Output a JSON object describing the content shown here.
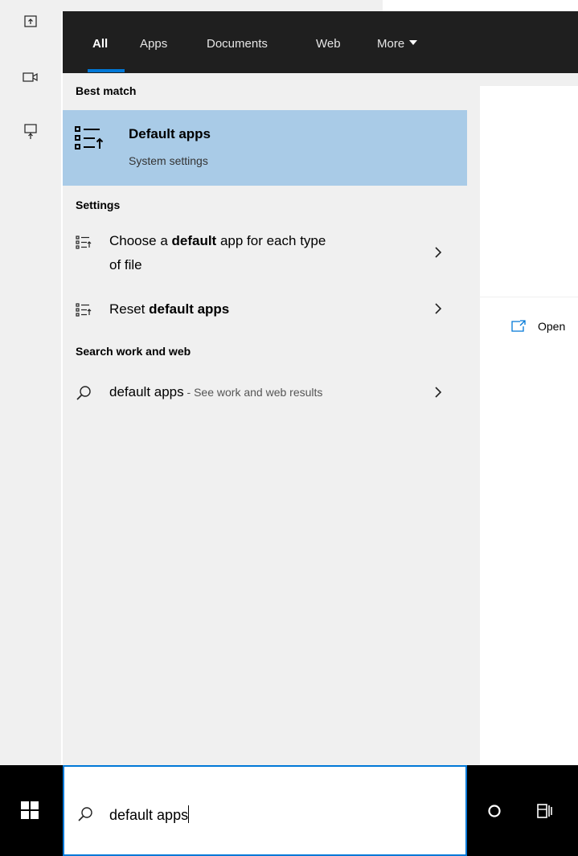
{
  "tabs": {
    "all": "All",
    "apps": "Apps",
    "documents": "Documents",
    "web": "Web",
    "more": "More"
  },
  "sections": {
    "best_match": "Best match",
    "settings": "Settings",
    "search_web": "Search work and web"
  },
  "best_match": {
    "title": "Default apps",
    "subtitle": "System settings",
    "icon": "default-apps-icon"
  },
  "settings_results": [
    {
      "prefix": "Choose a ",
      "bold": "default",
      "suffix_line1": " app for each type",
      "line2": "of file"
    },
    {
      "prefix": "Reset ",
      "bold": "default apps",
      "suffix": ""
    }
  ],
  "web_result": {
    "query": "default apps",
    "separator": " - ",
    "hint": "See work and web results"
  },
  "preview": {
    "open_label": "Open"
  },
  "search": {
    "value": "default apps"
  },
  "colors": {
    "accent": "#0078d7",
    "selected": "#a9cbe7",
    "tabbar": "#1f1f1f"
  }
}
